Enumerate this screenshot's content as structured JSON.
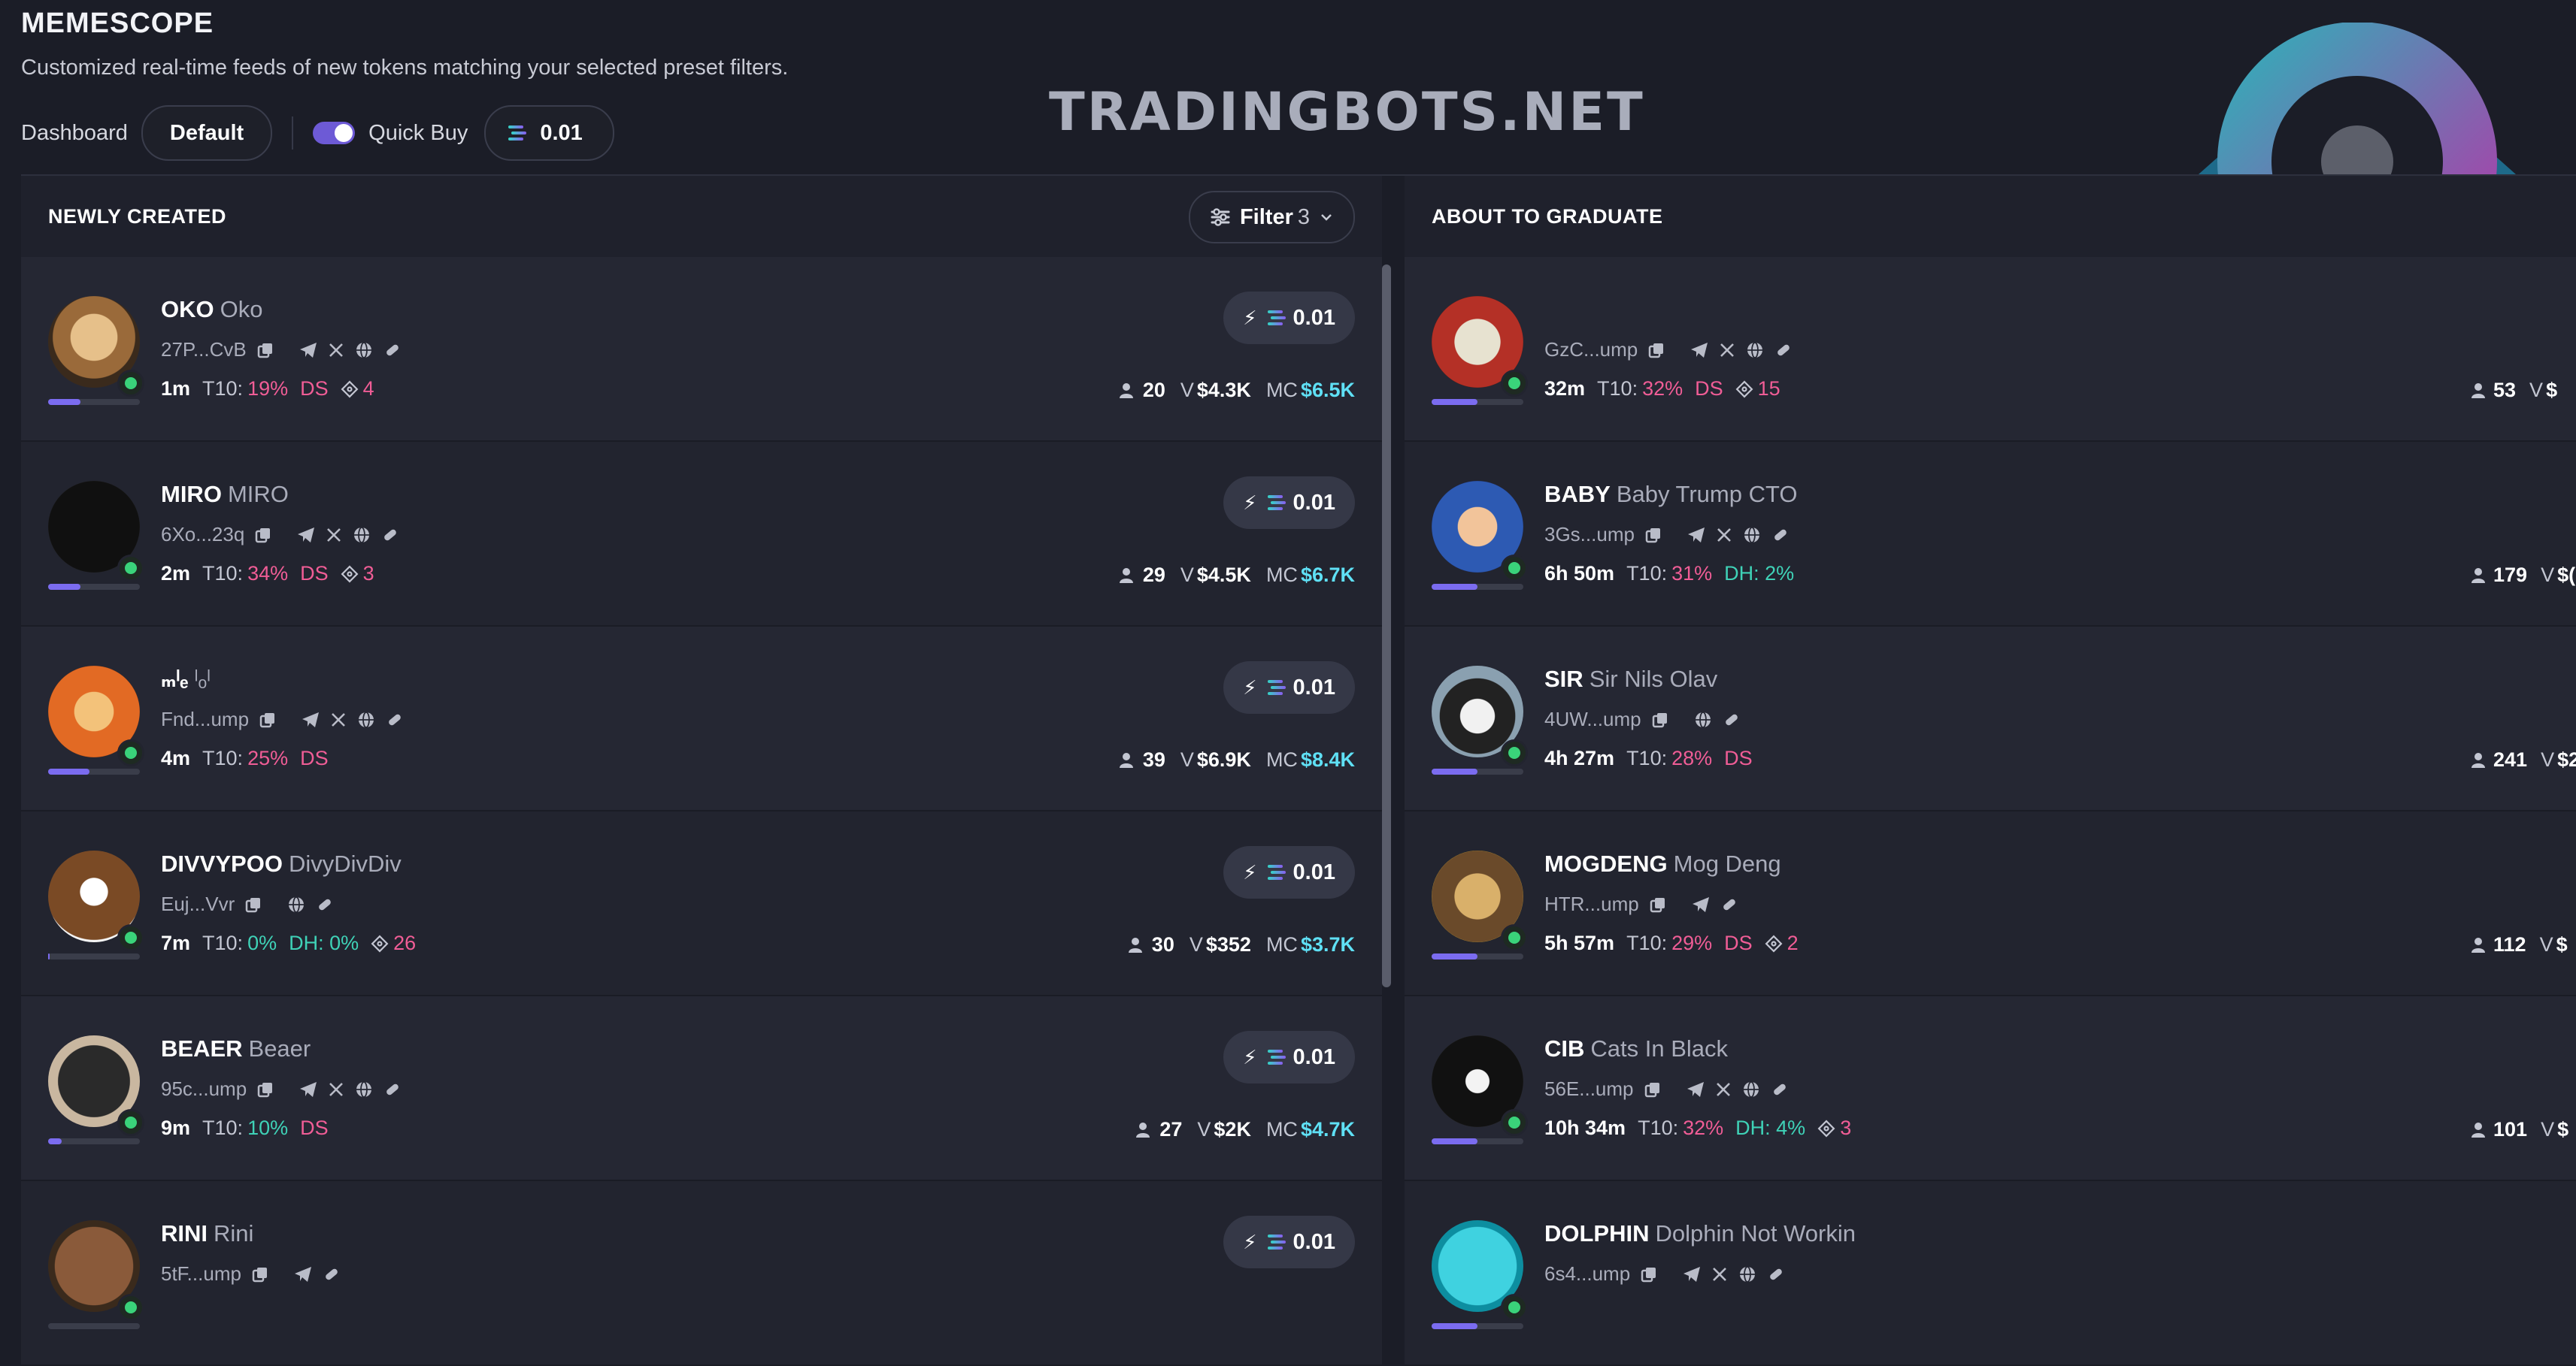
{
  "header": {
    "title": "MEMESCOPE",
    "subtitle": "Customized real-time feeds of new tokens matching your selected preset filters.",
    "dashboard_label": "Dashboard",
    "dashboard_value": "Default",
    "quick_buy_label": "Quick Buy",
    "quick_buy_enabled": true,
    "quick_buy_amount": "0.01"
  },
  "watermark": "TRADINGBOTS.NET",
  "colors": {
    "accent": "#7b6cf0",
    "pink": "#f05d96",
    "teal": "#3fd2b7",
    "cyan": "#5fe0f5"
  },
  "newly_created": {
    "title": "NEWLY CREATED",
    "filter_label": "Filter",
    "filter_count": "3",
    "rows": [
      {
        "ticker": "OKO",
        "name": "Oko",
        "addr": "27P...CvB",
        "age": "1m",
        "t10_label": "T10:",
        "t10": "19%",
        "flag": "DS",
        "holders_icon_count": "4",
        "users": "20",
        "vol_label": "V",
        "vol": "$4.3K",
        "mc_label": "MC",
        "mc": "$6.5K",
        "buy": "0.01",
        "progress": 0.35
      },
      {
        "ticker": "MIRO",
        "name": "MIRO",
        "addr": "6Xo...23q",
        "age": "2m",
        "t10_label": "T10:",
        "t10": "34%",
        "flag": "DS",
        "holders_icon_count": "3",
        "users": "29",
        "vol_label": "V",
        "vol": "$4.5K",
        "mc_label": "MC",
        "mc": "$6.7K",
        "buy": "0.01",
        "progress": 0.35
      },
      {
        "ticker": "ₘˡₑ",
        "name": "ˡₒˡ",
        "addr": "Fnd...ump",
        "age": "4m",
        "t10_label": "T10:",
        "t10": "25%",
        "flag": "DS",
        "holders_icon_count": "",
        "users": "39",
        "vol_label": "V",
        "vol": "$6.9K",
        "mc_label": "MC",
        "mc": "$8.4K",
        "buy": "0.01",
        "progress": 0.45
      },
      {
        "ticker": "DIVVYPOO",
        "name": "DivyDivDiv",
        "addr": "Euj...Vvr",
        "age": "7m",
        "t10_label": "T10:",
        "t10": "0%",
        "flag": "DH: 0%",
        "holders_icon_count": "26",
        "users": "30",
        "vol_label": "V",
        "vol": "$352",
        "mc_label": "MC",
        "mc": "$3.7K",
        "buy": "0.01",
        "progress": 0.02
      },
      {
        "ticker": "BEAER",
        "name": "Beaer",
        "addr": "95c...ump",
        "age": "9m",
        "t10_label": "T10:",
        "t10": "10%",
        "flag": "DS",
        "holders_icon_count": "",
        "users": "27",
        "vol_label": "V",
        "vol": "$2K",
        "mc_label": "MC",
        "mc": "$4.7K",
        "buy": "0.01",
        "progress": 0.15
      },
      {
        "ticker": "RINI",
        "name": "Rini",
        "addr": "5tF...ump",
        "age": "",
        "t10_label": "",
        "t10": "",
        "flag": "",
        "holders_icon_count": "",
        "users": "",
        "vol_label": "",
        "vol": "",
        "mc_label": "",
        "mc": "",
        "buy": "0.01",
        "progress": 0
      }
    ]
  },
  "about_to_graduate": {
    "title": "ABOUT TO GRADUATE",
    "rows": [
      {
        "ticker": "",
        "name": "",
        "addr": "GzC...ump",
        "age": "32m",
        "t10_label": "T10:",
        "t10": "32%",
        "flag": "DS",
        "holders_icon_count": "15",
        "users": "53",
        "vol_label": "V",
        "vol": "$"
      },
      {
        "ticker": "BABY",
        "name": "Baby Trump CTO",
        "addr": "3Gs...ump",
        "age": "6h 50m",
        "t10_label": "T10:",
        "t10": "31%",
        "flag": "DH: 2%",
        "holders_icon_count": "",
        "users": "179",
        "vol_label": "V",
        "vol": "$("
      },
      {
        "ticker": "SIR",
        "name": "Sir Nils Olav",
        "addr": "4UW...ump",
        "age": "4h 27m",
        "t10_label": "T10:",
        "t10": "28%",
        "flag": "DS",
        "holders_icon_count": "",
        "users": "241",
        "vol_label": "V",
        "vol": "$2("
      },
      {
        "ticker": "MOGDENG",
        "name": "Mog Deng",
        "addr": "HTR...ump",
        "age": "5h 57m",
        "t10_label": "T10:",
        "t10": "29%",
        "flag": "DS",
        "holders_icon_count": "2",
        "users": "112",
        "vol_label": "V",
        "vol": "$"
      },
      {
        "ticker": "CIB",
        "name": "Cats In Black",
        "addr": "56E...ump",
        "age": "10h 34m",
        "t10_label": "T10:",
        "t10": "32%",
        "flag": "DH: 4%",
        "holders_icon_count": "3",
        "users": "101",
        "vol_label": "V",
        "vol": "$"
      },
      {
        "ticker": "DOLPHIN",
        "name": "Dolphin Not Workin",
        "addr": "6s4...ump",
        "age": "",
        "t10_label": "",
        "t10": "",
        "flag": "",
        "holders_icon_count": "",
        "users": "",
        "vol_label": "",
        "vol": ""
      }
    ]
  }
}
